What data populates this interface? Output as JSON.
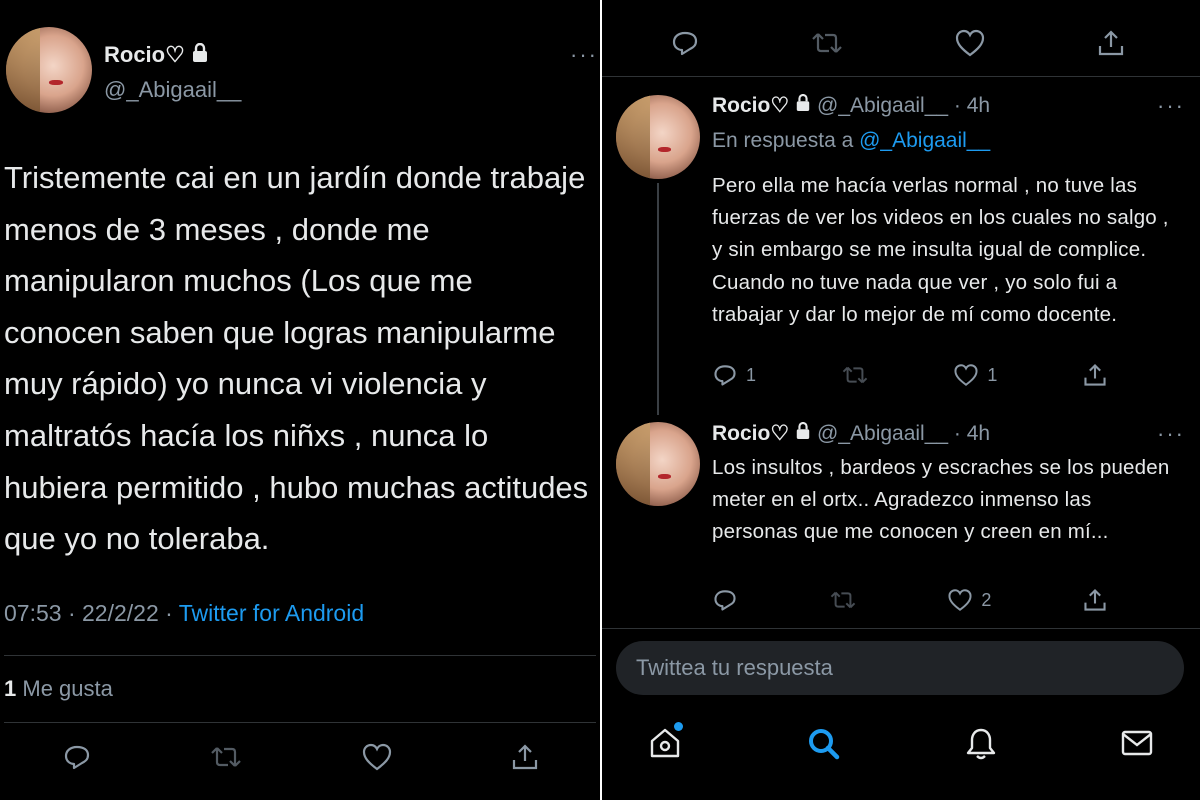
{
  "main_tweet": {
    "author_name": "Rocio♡",
    "handle": "@_Abigaail__",
    "more": "···",
    "text": "Tristemente cai en un jardín  donde trabaje menos de 3 meses , donde me manipularon muchos (Los que me conocen saben que logras manipularme muy rápido) yo nunca vi violencia y maltratós hacía los niñxs , nunca lo hubiera permitido , hubo muchas actitudes que yo no toleraba.",
    "timestamp": "07:53 · 22/2/22 · ",
    "client": "Twitter for Android",
    "likes_count": "1",
    "likes_label": " Me gusta"
  },
  "replies": [
    {
      "author_name": "Rocio♡",
      "handle_time": " @_Abigaail__ · 4h",
      "more": "···",
      "reply_prefix": "En respuesta a ",
      "reply_mention": "@_Abigaail__",
      "text": "Pero ella me hacía verlas normal , no tuve las fuerzas de ver los videos en los cuales no salgo , y sin embargo se me insulta igual de complice. Cuando no tuve nada que ver , yo solo fui a trabajar y dar lo mejor de mí como docente.",
      "reply_count": "1",
      "like_count": "1"
    },
    {
      "author_name": "Rocio♡",
      "handle_time": " @_Abigaail__ · 4h",
      "more": "···",
      "text": "Los insultos , bardeos y escraches se los pueden meter en el ortx.. Agradezco inmenso las personas que me conocen y creen en mí...",
      "like_count": "2"
    }
  ],
  "reply_input": {
    "placeholder": "Twittea tu respuesta"
  },
  "nav": {
    "items": [
      "home-icon",
      "search-icon",
      "notifications-icon",
      "messages-icon"
    ],
    "active": "search-icon",
    "accent": "#1d9bf0"
  },
  "colors": {
    "background": "#000000",
    "text": "#e7e9ea",
    "secondary": "#8b98a5",
    "link": "#1d9bf0"
  }
}
